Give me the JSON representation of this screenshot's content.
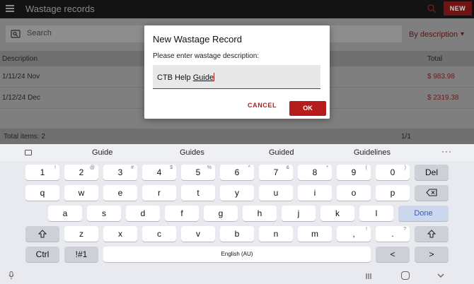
{
  "topbar": {
    "title": "Wastage records",
    "new_label": "NEW"
  },
  "search": {
    "placeholder": "Search",
    "sort_label": "By description"
  },
  "table": {
    "headers": {
      "description": "Description",
      "total": "Total"
    },
    "rows": [
      {
        "description": "1/11/24 Nov",
        "total": "$ 983.98"
      },
      {
        "description": "1/12/24 Dec",
        "total": "$ 2319.38"
      }
    ]
  },
  "footer": {
    "total_items": "Total items: 2",
    "page": "1/1"
  },
  "dialog": {
    "title": "New Wastage Record",
    "prompt": "Please enter wastage description:",
    "input_prefix": "CTB Help ",
    "input_underlined": "Guide",
    "cancel_label": "CANCEL",
    "ok_label": "OK"
  },
  "keyboard": {
    "suggestions": [
      "Guide",
      "Guides",
      "Guided",
      "Guidelines"
    ],
    "suggest_more": "···",
    "row1": [
      {
        "k": "1",
        "h": "!"
      },
      {
        "k": "2",
        "h": "@"
      },
      {
        "k": "3",
        "h": "#"
      },
      {
        "k": "4",
        "h": "$"
      },
      {
        "k": "5",
        "h": "%"
      },
      {
        "k": "6",
        "h": "^"
      },
      {
        "k": "7",
        "h": "&"
      },
      {
        "k": "8",
        "h": "*"
      },
      {
        "k": "9",
        "h": "("
      },
      {
        "k": "0",
        "h": ")"
      }
    ],
    "del": "Del",
    "row2": [
      "q",
      "w",
      "e",
      "r",
      "t",
      "y",
      "u",
      "i",
      "o",
      "p"
    ],
    "row3": [
      "a",
      "s",
      "d",
      "f",
      "g",
      "h",
      "j",
      "k",
      "l"
    ],
    "done": "Done",
    "row4": [
      "z",
      "x",
      "c",
      "v",
      "b",
      "n",
      "m"
    ],
    "comma": ",",
    "comma_hint": "!",
    "period": ".",
    "period_hint": "?",
    "ctrl": "Ctrl",
    "symbols": "!#1",
    "space": "English (AU)",
    "left": "<",
    "right": ">"
  },
  "colors": {
    "accent": "#b71c1c",
    "topbar": "#131313"
  }
}
